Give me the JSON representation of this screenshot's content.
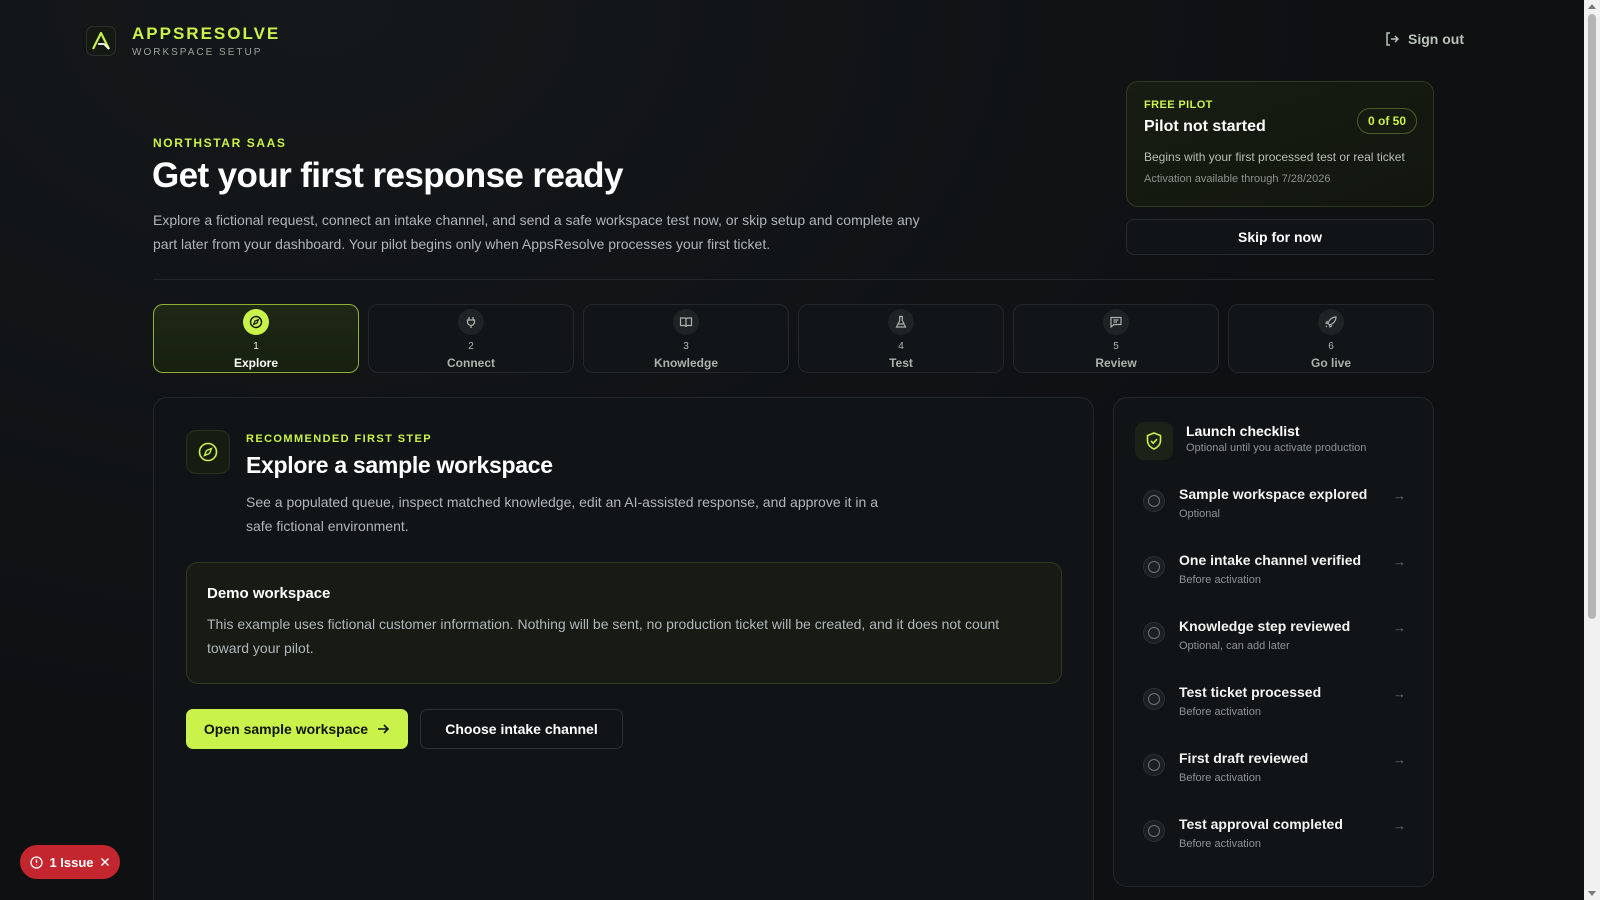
{
  "header": {
    "brand_name": "APPSRESOLVE",
    "brand_sub": "WORKSPACE SETUP",
    "signout_label": "Sign out"
  },
  "hero": {
    "eyebrow": "NORTHSTAR SAAS",
    "title": "Get your first response ready",
    "description": "Explore a fictional request, connect an intake channel, and send a safe workspace test now, or skip setup and complete any part later from your dashboard. Your pilot begins only when AppsResolve processes your first ticket."
  },
  "pilot": {
    "eyebrow": "FREE PILOT",
    "title": "Pilot not started",
    "badge": "0 of 50",
    "line1": "Begins with your first processed test or real ticket",
    "line2": "Activation available through 7/28/2026",
    "skip_label": "Skip for now"
  },
  "steps": [
    {
      "num": "1",
      "label": "Explore",
      "icon": "compass-icon",
      "active": true
    },
    {
      "num": "2",
      "label": "Connect",
      "icon": "plug-icon",
      "active": false
    },
    {
      "num": "3",
      "label": "Knowledge",
      "icon": "book-icon",
      "active": false
    },
    {
      "num": "4",
      "label": "Test",
      "icon": "flask-icon",
      "active": false
    },
    {
      "num": "5",
      "label": "Review",
      "icon": "message-icon",
      "active": false
    },
    {
      "num": "6",
      "label": "Go live",
      "icon": "rocket-icon",
      "active": false
    }
  ],
  "main": {
    "eyebrow": "RECOMMENDED FIRST STEP",
    "title": "Explore a sample workspace",
    "description": "See a populated queue, inspect matched knowledge, edit an AI-assisted response, and approve it in a safe fictional environment.",
    "demo_title": "Demo workspace",
    "demo_text": "This example uses fictional customer information. Nothing will be sent, no production ticket will be created, and it does not count toward your pilot.",
    "primary_label": "Open sample workspace",
    "secondary_label": "Choose intake channel"
  },
  "checklist": {
    "title": "Launch checklist",
    "subtitle": "Optional until you activate production",
    "items": [
      {
        "name": "Sample workspace explored",
        "note": "Optional"
      },
      {
        "name": "One intake channel verified",
        "note": "Before activation"
      },
      {
        "name": "Knowledge step reviewed",
        "note": "Optional, can add later"
      },
      {
        "name": "Test ticket processed",
        "note": "Before activation"
      },
      {
        "name": "First draft reviewed",
        "note": "Before activation"
      },
      {
        "name": "Test approval completed",
        "note": "Before activation"
      }
    ]
  },
  "issue_badge": {
    "label": "1 Issue"
  },
  "colors": {
    "accent": "#c9f24a",
    "background": "#0e1012",
    "danger": "#c4262f"
  }
}
